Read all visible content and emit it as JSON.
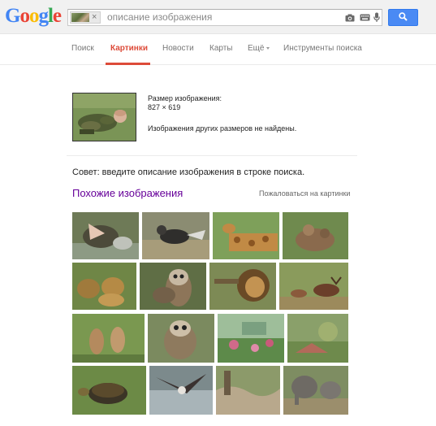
{
  "logo": "Google",
  "search": {
    "query_placeholder": "описание изображения",
    "chip_close": "×",
    "icons": [
      "camera-icon",
      "keyboard-icon",
      "microphone-icon",
      "search-icon"
    ]
  },
  "nav": {
    "items": [
      "Поиск",
      "Картинки",
      "Новости",
      "Карты",
      "Ещё",
      "Инструменты поиска"
    ],
    "active": "Картинки"
  },
  "image_info": {
    "size_label": "Размер изображения:",
    "size_value": "827 × 619",
    "no_other_sizes": "Изображения других размеров не найдены."
  },
  "tip": "Совет: введите описание изображения в строке поиска.",
  "similar": {
    "title": "Похожие изображения",
    "report_link": "Пожаловаться на картинки",
    "thumbnails": [
      "crocodile-photo",
      "fox-photo",
      "giraffe-photo",
      "deer-photo",
      "lions-photo",
      "owl-photo",
      "lion-photo",
      "elk-photo",
      "kangaroos-photo",
      "owl-photo-2",
      "garden-photo",
      "garden-photo-2",
      "turtle-photo",
      "eagle-photo",
      "river-photo",
      "elephants-photo"
    ]
  },
  "colors": {
    "accent_active": "#dd4b39",
    "search_button": "#4a8af4",
    "similar_title": "#660099"
  }
}
